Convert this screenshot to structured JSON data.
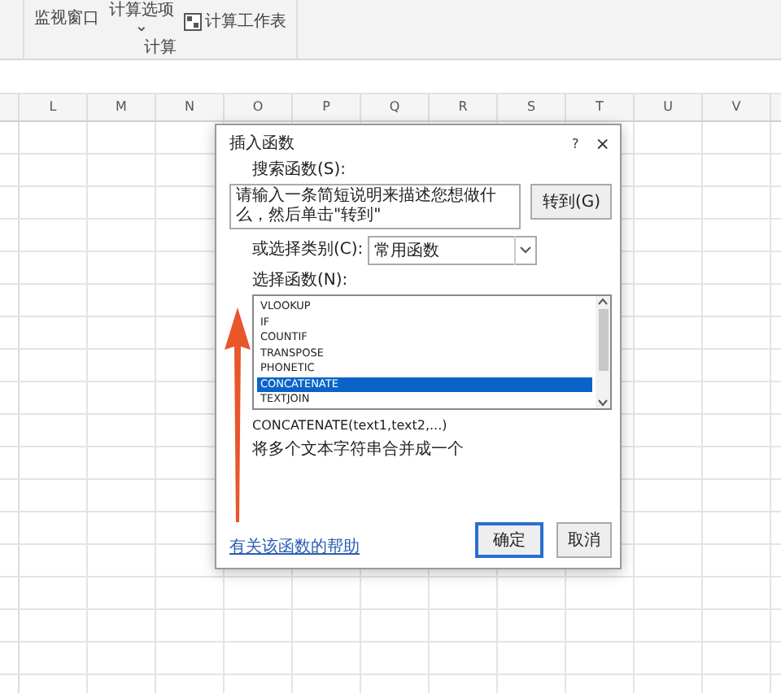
{
  "ribbon": {
    "items": [
      {
        "kind": "text",
        "label": "监视窗口"
      },
      {
        "kind": "dropdown",
        "label": "计算选项",
        "caret": "⌄"
      },
      {
        "kind": "icon",
        "label": "计算工作表"
      }
    ],
    "group_label": "计算"
  },
  "sheet": {
    "columns": [
      "L",
      "M",
      "N",
      "O",
      "P",
      "Q",
      "R",
      "S",
      "T",
      "U",
      "V"
    ]
  },
  "dialog": {
    "title": "插入函数",
    "help": "?",
    "close": "×",
    "search_label": "搜索函数(S):",
    "search_value": "请输入一条简短说明来描述您想做什么，然后单击\"转到\"",
    "go_button": "转到(G)",
    "category_label": "或选择类别(C):",
    "category_value": "常用函数",
    "list_label": "选择函数(N):",
    "functions": [
      {
        "name": "VLOOKUP",
        "selected": false
      },
      {
        "name": "IF",
        "selected": false
      },
      {
        "name": "COUNTIF",
        "selected": false
      },
      {
        "name": "TRANSPOSE",
        "selected": false
      },
      {
        "name": "PHONETIC",
        "selected": false
      },
      {
        "name": "CONCATENATE",
        "selected": true
      },
      {
        "name": "TEXTJOIN",
        "selected": false
      }
    ],
    "signature": "CONCATENATE(text1,text2,...)",
    "description": "将多个文本字符串合并成一个",
    "help_link": "有关该函数的帮助",
    "buttons": [
      {
        "label": "确定",
        "default": true
      },
      {
        "label": "取消",
        "default": false
      }
    ]
  }
}
